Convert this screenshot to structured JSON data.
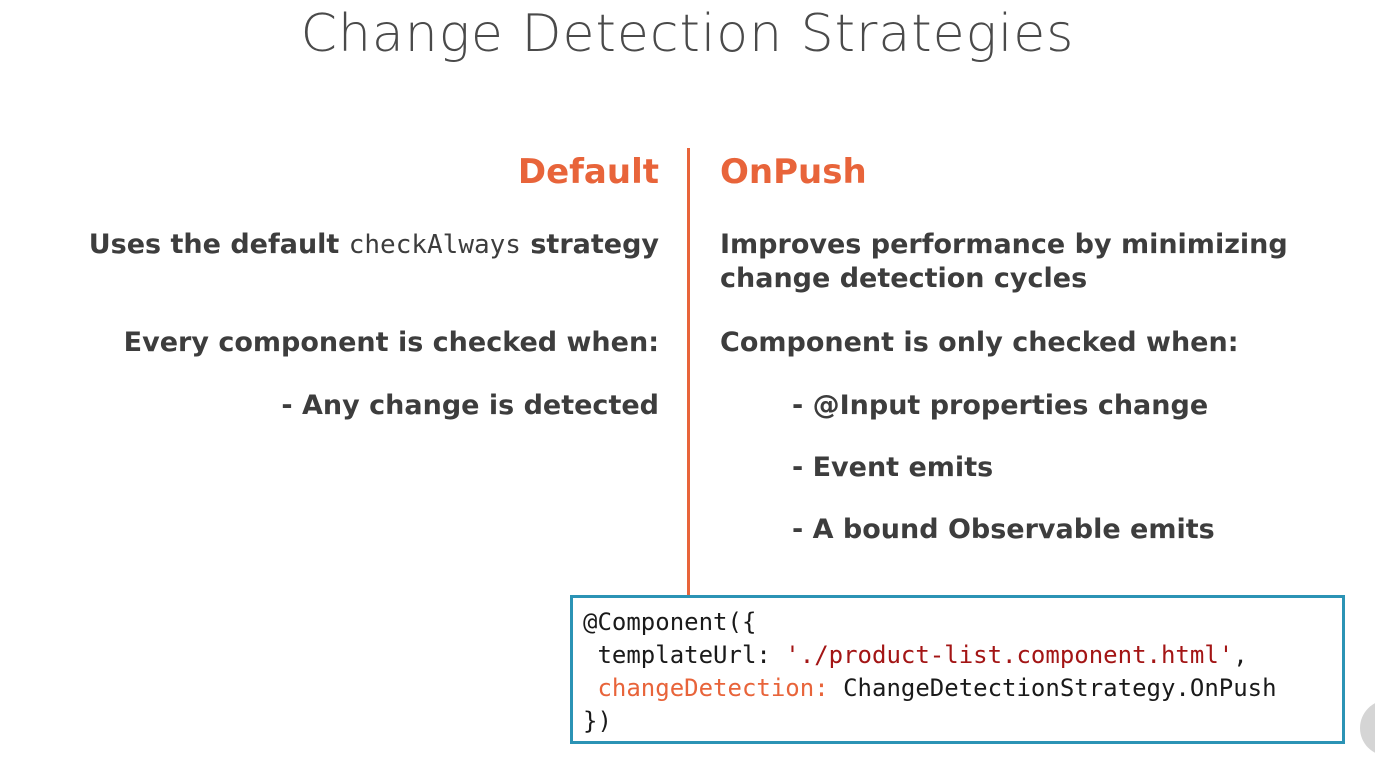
{
  "title": "Change Detection Strategies",
  "accent_color": "#e8643a",
  "code_border_color": "#2b93b5",
  "left": {
    "heading": "Default",
    "line1_prefix": "Uses the default ",
    "line1_code": "checkAlways",
    "line1_suffix": " strategy",
    "line2": "Every component is checked when:",
    "bullet1": "- Any change is detected"
  },
  "right": {
    "heading": "OnPush",
    "line1a": "Improves performance by minimizing",
    "line1b": "change detection cycles",
    "line2": "Component is only checked when:",
    "bullets": [
      "- @Input properties change",
      "- Event emits",
      "- A bound Observable emits"
    ]
  },
  "code": {
    "line1": "@Component({",
    "line2_key": " templateUrl: ",
    "line2_value": "'./product-list.component.html'",
    "line2_end": ",",
    "line3_key": " changeDetection: ",
    "line3_value": "ChangeDetectionStrategy.OnPush",
    "line4": "})"
  }
}
